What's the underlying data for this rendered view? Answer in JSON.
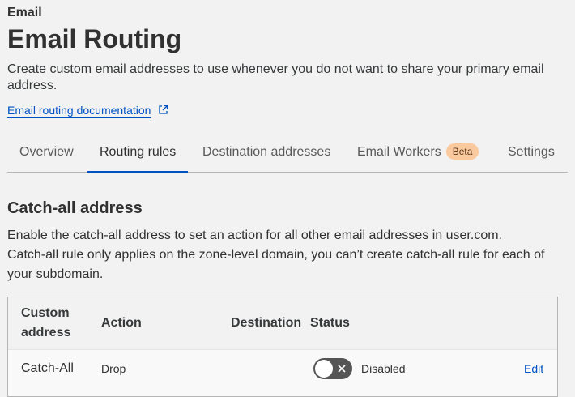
{
  "breadcrumb": "Email",
  "page_title": "Email Routing",
  "description": "Create custom email addresses to use whenever you do not want to share your primary email address.",
  "doc_link": "Email routing documentation",
  "tabs": [
    {
      "label": "Overview"
    },
    {
      "label": "Routing rules"
    },
    {
      "label": "Destination addresses"
    },
    {
      "label": "Email Workers",
      "badge": "Beta"
    },
    {
      "label": "Settings"
    }
  ],
  "active_tab": "Routing rules",
  "catch_all": {
    "title": "Catch-all address",
    "description_line1": "Enable the catch-all address to set an action for all other email addresses in user.com.",
    "description_line2": "Catch-all rule only applies on the zone-level domain, you can’t create catch-all rule for each of your subdomain."
  },
  "table": {
    "headers": [
      "Custom address",
      "Action",
      "Destination",
      "Status"
    ],
    "rows": [
      {
        "custom_address": "Catch-All",
        "action": "Drop",
        "destination": "",
        "status": "Disabled",
        "enabled": false,
        "edit_label": "Edit"
      }
    ]
  },
  "colors": {
    "link": "#0051c3",
    "badge_bg": "#fbc99e",
    "toggle_off": "#555555",
    "background": "#f2f2f2"
  },
  "icons": {
    "external_link": "external-link-icon",
    "toggle_off": "close-icon"
  }
}
